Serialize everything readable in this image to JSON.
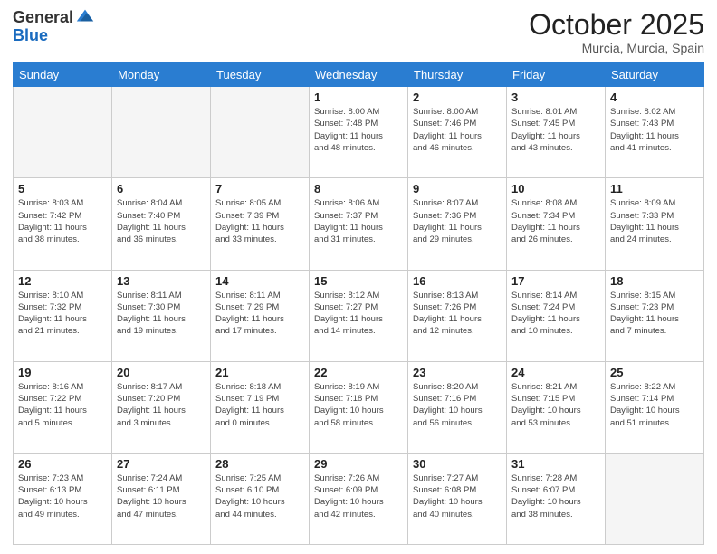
{
  "logo": {
    "general": "General",
    "blue": "Blue"
  },
  "header": {
    "month": "October 2025",
    "location": "Murcia, Murcia, Spain"
  },
  "weekdays": [
    "Sunday",
    "Monday",
    "Tuesday",
    "Wednesday",
    "Thursday",
    "Friday",
    "Saturday"
  ],
  "weeks": [
    [
      {
        "day": "",
        "info": ""
      },
      {
        "day": "",
        "info": ""
      },
      {
        "day": "",
        "info": ""
      },
      {
        "day": "1",
        "info": "Sunrise: 8:00 AM\nSunset: 7:48 PM\nDaylight: 11 hours\nand 48 minutes."
      },
      {
        "day": "2",
        "info": "Sunrise: 8:00 AM\nSunset: 7:46 PM\nDaylight: 11 hours\nand 46 minutes."
      },
      {
        "day": "3",
        "info": "Sunrise: 8:01 AM\nSunset: 7:45 PM\nDaylight: 11 hours\nand 43 minutes."
      },
      {
        "day": "4",
        "info": "Sunrise: 8:02 AM\nSunset: 7:43 PM\nDaylight: 11 hours\nand 41 minutes."
      }
    ],
    [
      {
        "day": "5",
        "info": "Sunrise: 8:03 AM\nSunset: 7:42 PM\nDaylight: 11 hours\nand 38 minutes."
      },
      {
        "day": "6",
        "info": "Sunrise: 8:04 AM\nSunset: 7:40 PM\nDaylight: 11 hours\nand 36 minutes."
      },
      {
        "day": "7",
        "info": "Sunrise: 8:05 AM\nSunset: 7:39 PM\nDaylight: 11 hours\nand 33 minutes."
      },
      {
        "day": "8",
        "info": "Sunrise: 8:06 AM\nSunset: 7:37 PM\nDaylight: 11 hours\nand 31 minutes."
      },
      {
        "day": "9",
        "info": "Sunrise: 8:07 AM\nSunset: 7:36 PM\nDaylight: 11 hours\nand 29 minutes."
      },
      {
        "day": "10",
        "info": "Sunrise: 8:08 AM\nSunset: 7:34 PM\nDaylight: 11 hours\nand 26 minutes."
      },
      {
        "day": "11",
        "info": "Sunrise: 8:09 AM\nSunset: 7:33 PM\nDaylight: 11 hours\nand 24 minutes."
      }
    ],
    [
      {
        "day": "12",
        "info": "Sunrise: 8:10 AM\nSunset: 7:32 PM\nDaylight: 11 hours\nand 21 minutes."
      },
      {
        "day": "13",
        "info": "Sunrise: 8:11 AM\nSunset: 7:30 PM\nDaylight: 11 hours\nand 19 minutes."
      },
      {
        "day": "14",
        "info": "Sunrise: 8:11 AM\nSunset: 7:29 PM\nDaylight: 11 hours\nand 17 minutes."
      },
      {
        "day": "15",
        "info": "Sunrise: 8:12 AM\nSunset: 7:27 PM\nDaylight: 11 hours\nand 14 minutes."
      },
      {
        "day": "16",
        "info": "Sunrise: 8:13 AM\nSunset: 7:26 PM\nDaylight: 11 hours\nand 12 minutes."
      },
      {
        "day": "17",
        "info": "Sunrise: 8:14 AM\nSunset: 7:24 PM\nDaylight: 11 hours\nand 10 minutes."
      },
      {
        "day": "18",
        "info": "Sunrise: 8:15 AM\nSunset: 7:23 PM\nDaylight: 11 hours\nand 7 minutes."
      }
    ],
    [
      {
        "day": "19",
        "info": "Sunrise: 8:16 AM\nSunset: 7:22 PM\nDaylight: 11 hours\nand 5 minutes."
      },
      {
        "day": "20",
        "info": "Sunrise: 8:17 AM\nSunset: 7:20 PM\nDaylight: 11 hours\nand 3 minutes."
      },
      {
        "day": "21",
        "info": "Sunrise: 8:18 AM\nSunset: 7:19 PM\nDaylight: 11 hours\nand 0 minutes."
      },
      {
        "day": "22",
        "info": "Sunrise: 8:19 AM\nSunset: 7:18 PM\nDaylight: 10 hours\nand 58 minutes."
      },
      {
        "day": "23",
        "info": "Sunrise: 8:20 AM\nSunset: 7:16 PM\nDaylight: 10 hours\nand 56 minutes."
      },
      {
        "day": "24",
        "info": "Sunrise: 8:21 AM\nSunset: 7:15 PM\nDaylight: 10 hours\nand 53 minutes."
      },
      {
        "day": "25",
        "info": "Sunrise: 8:22 AM\nSunset: 7:14 PM\nDaylight: 10 hours\nand 51 minutes."
      }
    ],
    [
      {
        "day": "26",
        "info": "Sunrise: 7:23 AM\nSunset: 6:13 PM\nDaylight: 10 hours\nand 49 minutes."
      },
      {
        "day": "27",
        "info": "Sunrise: 7:24 AM\nSunset: 6:11 PM\nDaylight: 10 hours\nand 47 minutes."
      },
      {
        "day": "28",
        "info": "Sunrise: 7:25 AM\nSunset: 6:10 PM\nDaylight: 10 hours\nand 44 minutes."
      },
      {
        "day": "29",
        "info": "Sunrise: 7:26 AM\nSunset: 6:09 PM\nDaylight: 10 hours\nand 42 minutes."
      },
      {
        "day": "30",
        "info": "Sunrise: 7:27 AM\nSunset: 6:08 PM\nDaylight: 10 hours\nand 40 minutes."
      },
      {
        "day": "31",
        "info": "Sunrise: 7:28 AM\nSunset: 6:07 PM\nDaylight: 10 hours\nand 38 minutes."
      },
      {
        "day": "",
        "info": ""
      }
    ]
  ]
}
